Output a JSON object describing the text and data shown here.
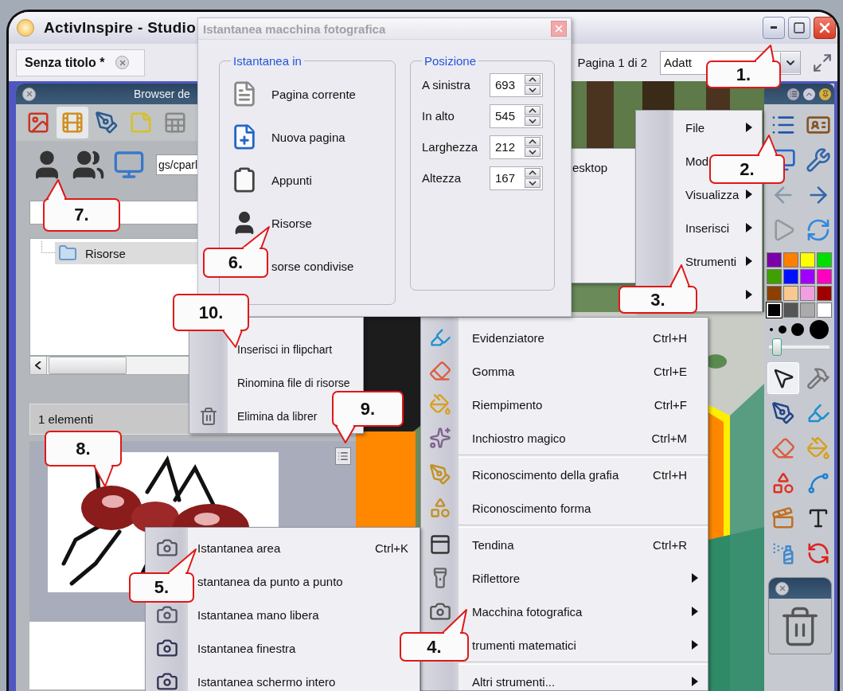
{
  "window": {
    "title": "ActivInspire - Studio"
  },
  "tabs": [
    {
      "label": "Senza titolo *",
      "selected": true
    }
  ],
  "page_indicator": "Pagina 1 di 2",
  "zoom_dropdown": {
    "value": "Adatt"
  },
  "browser": {
    "title": "Browser de",
    "tabs": [
      {
        "selected": false
      },
      {
        "selected": true
      },
      {
        "selected": false
      },
      {
        "selected": false
      },
      {
        "selected": false
      }
    ],
    "path": "gs/cparl",
    "tree": [
      {
        "label": "Risorse",
        "selected": true
      }
    ],
    "item_count": "1 elementi"
  },
  "dialog": {
    "title": "Istantanea macchina fotografica",
    "target_group": {
      "title": "Istantanea in",
      "options": [
        {
          "kind": "page",
          "label": "Pagina corrente"
        },
        {
          "kind": "new-page",
          "label": "Nuova pagina"
        },
        {
          "kind": "clipboard",
          "label": "Appunti"
        },
        {
          "kind": "person",
          "label": "Risorse"
        },
        {
          "label": "sorse condivise"
        }
      ]
    },
    "position_group": {
      "title": "Posizione",
      "fields": [
        {
          "label": "A sinistra",
          "value": "693"
        },
        {
          "label": "In alto",
          "value": "545"
        },
        {
          "label": "Larghezza",
          "value": "212"
        },
        {
          "label": "Altezza",
          "value": "167"
        }
      ]
    }
  },
  "background_menu": {
    "items": [
      {
        "label": "esktop"
      }
    ]
  },
  "main_menu": {
    "items": [
      {
        "label": "File",
        "submenu": true
      },
      {
        "label": "Mod"
      },
      {
        "label": "Visualizza",
        "submenu": true
      },
      {
        "label": "Inserisci",
        "submenu": true
      },
      {
        "label": "Strumenti",
        "submenu": true
      },
      {
        "submenu": true
      }
    ]
  },
  "tools_menu": {
    "groups": [
      [
        {
          "kind": "highlighter",
          "label": "Evidenziatore",
          "shortcut": "Ctrl+H",
          "submenu": false
        },
        {
          "kind": "eraser",
          "label": "Gomma",
          "shortcut": "Ctrl+E",
          "submenu": false
        },
        {
          "kind": "fill",
          "label": "Riempimento",
          "shortcut": "Ctrl+F",
          "submenu": false
        },
        {
          "kind": "magic-ink",
          "label": "Inchiostro magico",
          "shortcut": "Ctrl+M",
          "submenu": false
        }
      ],
      [
        {
          "kind": "handwriting",
          "label": "Riconoscimento della grafia",
          "shortcut": "Ctrl+H",
          "submenu": false
        },
        {
          "kind": "shape",
          "label": "Riconoscimento forma",
          "submenu": false
        }
      ],
      [
        {
          "kind": "curtain",
          "label": "Tendina",
          "shortcut": "Ctrl+R",
          "submenu": false
        },
        {
          "kind": "spotlight",
          "label": "Riflettore",
          "submenu": true
        },
        {
          "kind": "camera",
          "label": "Macchina fotografica",
          "submenu": true
        },
        {
          "label": "trumenti matematici",
          "submenu": true
        }
      ],
      [
        {
          "label": "Altri strumenti...",
          "submenu": true
        }
      ]
    ]
  },
  "resource_menu": {
    "items": [
      {
        "label": "Inserisci in flipchart"
      },
      {
        "label": "Rinomina file di risorse"
      },
      {
        "kind": "delete",
        "label": "Elimina da librer"
      }
    ]
  },
  "camera_menu": {
    "items": [
      {
        "kind": "area",
        "label": "Istantanea area",
        "shortcut": "Ctrl+K"
      },
      {
        "label": "stantanea da punto a punto"
      },
      {
        "kind": "freehand",
        "label": "Istantanea mano libera"
      },
      {
        "kind": "window",
        "label": "Istantanea finestra"
      },
      {
        "kind": "screen",
        "label": "Istantanea schermo intero"
      }
    ]
  },
  "toolbox": {
    "palette": [
      {
        "color": "#7b00a8",
        "selected": false
      },
      {
        "color": "#ff8000",
        "selected": false
      },
      {
        "color": "#ffff00",
        "selected": false
      },
      {
        "color": "#00e000",
        "selected": false
      },
      {
        "color": "#40a000",
        "selected": false
      },
      {
        "color": "#0010ff",
        "selected": false
      },
      {
        "color": "#a000ff",
        "selected": false
      },
      {
        "color": "#ff00c0",
        "selected": false
      },
      {
        "color": "#8b4000",
        "selected": false
      },
      {
        "color": "#f8c890",
        "selected": false
      },
      {
        "color": "#f0a0e0",
        "selected": false
      },
      {
        "color": "#a00000",
        "selected": false
      },
      {
        "color": "#000000",
        "selected": true
      },
      {
        "color": "#555555",
        "selected": false
      },
      {
        "color": "#aaaaaa",
        "selected": false
      },
      {
        "color": "#ffffff",
        "selected": false
      }
    ],
    "pen_width": {
      "level": 0.05
    },
    "tools": [
      {
        "selected": true
      },
      {
        "selected": false
      },
      {
        "selected": false
      },
      {
        "selected": false
      },
      {
        "selected": false
      },
      {
        "selected": false
      },
      {
        "selected": false
      },
      {
        "selected": false
      },
      {
        "selected": false
      },
      {
        "selected": false
      },
      {
        "selected": false
      },
      {
        "selected": false
      }
    ]
  },
  "callouts": [
    {
      "label": "1."
    },
    {
      "label": "2."
    },
    {
      "label": "3."
    },
    {
      "label": "4."
    },
    {
      "label": "5."
    },
    {
      "label": "6."
    },
    {
      "label": "7."
    },
    {
      "label": "8."
    },
    {
      "label": "9."
    },
    {
      "label": "10."
    }
  ]
}
